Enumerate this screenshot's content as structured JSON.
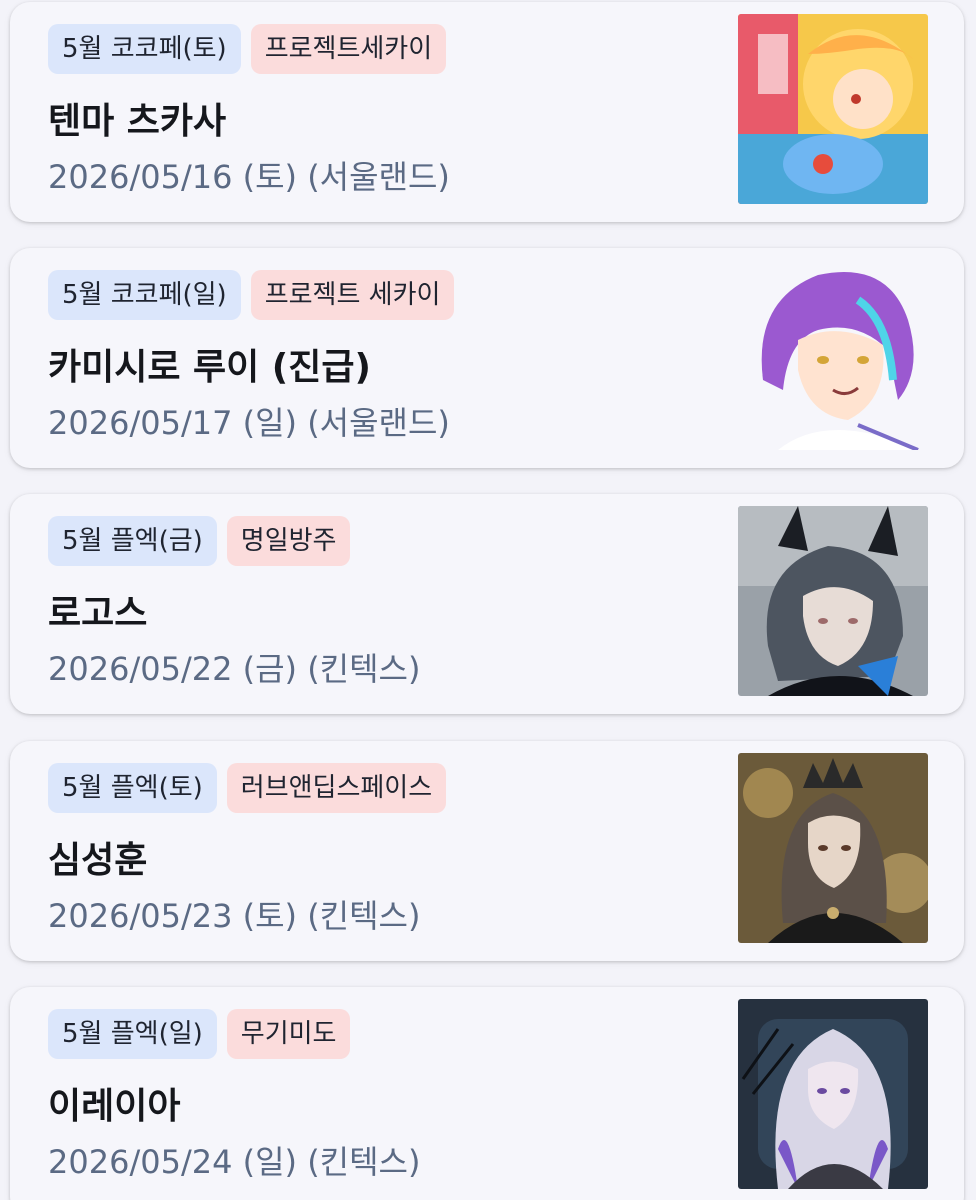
{
  "events": [
    {
      "event_tag": "5월 코코페(토)",
      "genre_tag": "프로젝트세카이",
      "character": "텐마 츠카사",
      "date": "2026/05/16 (토) (서울랜드)",
      "image": "anime-character-blonde-thumbnail"
    },
    {
      "event_tag": "5월 코코페(일)",
      "genre_tag": "프로젝트 세카이",
      "character": "카미시로 루이 (진급)",
      "date": "2026/05/17 (일) (서울랜드)",
      "image": "anime-character-purple-hair-thumbnail"
    },
    {
      "event_tag": "5월 플엑(금)",
      "genre_tag": "명일방주",
      "character": "로고스",
      "date": "2026/05/22 (금) (킨텍스)",
      "image": "anime-character-gray-hair-horns-thumbnail"
    },
    {
      "event_tag": "5월 플엑(토)",
      "genre_tag": "러브앤딥스페이스",
      "character": "심성훈",
      "date": "2026/05/23 (토) (킨텍스)",
      "image": "character-crowned-long-hair-thumbnail"
    },
    {
      "event_tag": "5월 플엑(일)",
      "genre_tag": "무기미도",
      "character": "이레이아",
      "date": "2026/05/24 (일) (킨텍스)",
      "image": "character-white-hair-thumbnail"
    }
  ]
}
